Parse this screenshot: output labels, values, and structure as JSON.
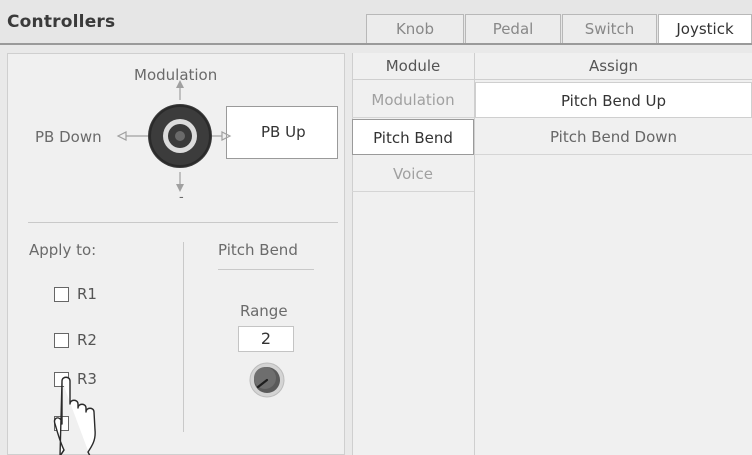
{
  "header": {
    "title": "Controllers",
    "tabs": [
      {
        "label": "Knob",
        "active": false
      },
      {
        "label": "Pedal",
        "active": false
      },
      {
        "label": "Switch",
        "active": false
      },
      {
        "label": "Joystick",
        "active": true
      }
    ]
  },
  "joystick": {
    "up_label": "Modulation",
    "left_label": "PB Down",
    "right_label": "PB Up",
    "down_label": "-"
  },
  "apply": {
    "label": "Apply to:",
    "options": [
      {
        "label": "R1",
        "checked": false
      },
      {
        "label": "R2",
        "checked": false
      },
      {
        "label": "R3",
        "checked": false
      },
      {
        "label": "",
        "checked": false
      }
    ]
  },
  "pitch_bend": {
    "title": "Pitch Bend",
    "range_label": "Range",
    "range_value": "2"
  },
  "table": {
    "module_header": "Module",
    "assign_header": "Assign",
    "modules": [
      {
        "label": "Modulation",
        "selected": false
      },
      {
        "label": "Pitch Bend",
        "selected": true
      },
      {
        "label": "Voice",
        "selected": false
      }
    ],
    "assigns": [
      {
        "label": "Pitch Bend Up",
        "selected": true
      },
      {
        "label": "Pitch Bend Down",
        "selected": false
      }
    ]
  },
  "icons": {
    "joystick": "joystick-icon",
    "knob": "knob-icon",
    "pointer": "hand-pointer-icon"
  }
}
